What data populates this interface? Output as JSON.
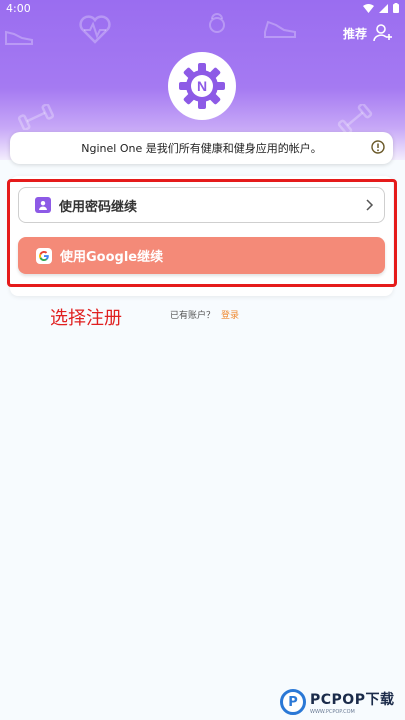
{
  "status_bar": {
    "time": "4:00"
  },
  "header": {
    "recommend_label": "推荐",
    "logo_letter": "N"
  },
  "info": {
    "text": "Nginel One 是我们所有健康和健身应用的帐户。"
  },
  "buttons": {
    "password_label": "使用密码继续",
    "google_label": "使用Google继续",
    "google_glyph": "G"
  },
  "annotation": {
    "text": "选择注册"
  },
  "login": {
    "prompt": "已有账户？",
    "link": "登录"
  },
  "watermark": {
    "logo_letter": "P",
    "main": "PCPOP下载",
    "sub": "WWW.PCPOP.COM"
  },
  "colors": {
    "header_gradient_top": "#9a6df0",
    "google_button": "#f48a78",
    "highlight_border": "#e51b1b",
    "annotation": "#e02020",
    "login_link": "#f08a30",
    "accent_purple": "#8d5ae6"
  },
  "icons": [
    "wifi-icon",
    "signal-icon",
    "battery-icon",
    "add-user-icon",
    "gear-logo-icon",
    "info-icon",
    "user-icon",
    "chevron-right-icon",
    "google-icon"
  ]
}
